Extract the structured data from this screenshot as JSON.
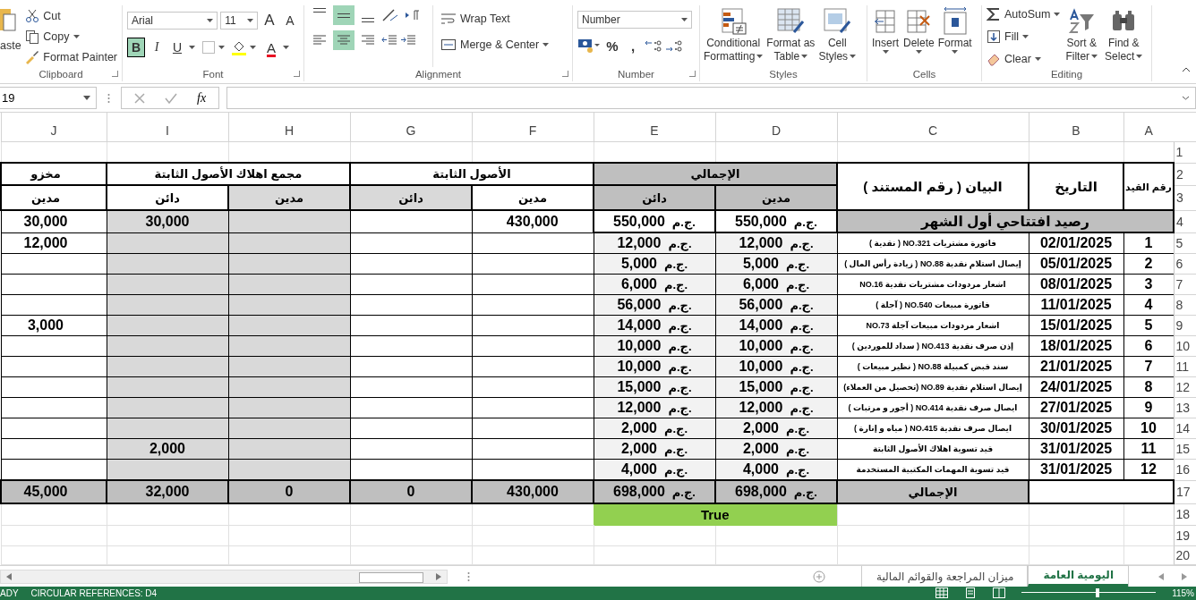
{
  "ribbon": {
    "clipboard": {
      "label": "Clipboard",
      "paste": "aste",
      "cut": "Cut",
      "copy": "Copy",
      "format_painter": "Format Painter"
    },
    "font": {
      "label": "Font",
      "font_name": "Arial",
      "font_size": "11",
      "grow": "A",
      "shrink": "A",
      "bold": {
        "glyph": "B",
        "selected": true
      },
      "italic": {
        "glyph": "I",
        "selected": false
      },
      "underline": {
        "glyph": "U",
        "selected": false
      },
      "font_color": "A"
    },
    "alignment": {
      "label": "Alignment",
      "vertical": [
        {
          "kind": "top",
          "selected": false
        },
        {
          "kind": "middle",
          "selected": true
        },
        {
          "kind": "bottom",
          "selected": false
        }
      ],
      "horizontal": [
        {
          "kind": "left",
          "selected": false
        },
        {
          "kind": "center",
          "selected": true
        },
        {
          "kind": "right",
          "selected": false
        }
      ],
      "wrap_text": "Wrap Text",
      "merge_center": "Merge & Center"
    },
    "number": {
      "label": "Number",
      "format": "Number",
      "percent": "%",
      "comma": ","
    },
    "styles": {
      "label": "Styles",
      "conditional_formatting": [
        "Conditional",
        "Formatting"
      ],
      "format_as_table": [
        "Format as",
        "Table"
      ],
      "cell_styles": [
        "Cell",
        "Styles"
      ]
    },
    "cells": {
      "label": "Cells",
      "insert": "Insert",
      "delete": "Delete",
      "format": "Format"
    },
    "editing": {
      "label": "Editing",
      "autosum": "AutoSum",
      "fill": "Fill",
      "clear": "Clear",
      "sort": [
        "Sort &",
        "Filter"
      ],
      "find": [
        "Find &",
        "Select"
      ]
    }
  },
  "formula_bar": {
    "name_box": "19",
    "fx": "fx"
  },
  "sheet": {
    "column_headers": [
      "A",
      "B",
      "C",
      "D",
      "E",
      "F",
      "G",
      "H",
      "I",
      "J"
    ],
    "row_numbers": [
      "1",
      "2",
      "3",
      "4",
      "5",
      "6",
      "7",
      "8",
      "9",
      "10",
      "11",
      "12",
      "13",
      "14",
      "15",
      "16",
      "17",
      "18",
      "19",
      "20"
    ],
    "headers": {
      "entry_no": "رقم القيد",
      "date": "التاريخ",
      "description": "البيان ( رقم المستند )",
      "total": "الإجمالي",
      "fixed_assets": "الأصول الثابتة",
      "depreciation": "مجمع اهلاك الأصول الثابتة",
      "column_j": "مخزو"
    },
    "sub_headers": [
      "مدين",
      "دائن",
      "مدين",
      "دائن",
      "مدين",
      "دائن",
      "مدين"
    ],
    "opening": {
      "label": "رصيد افتتاحي أول الشهر",
      "debit": {
        "currency": "ج.م.",
        "amount": "550,000"
      },
      "credit": {
        "currency": "ج.م.",
        "amount": "550,000"
      },
      "fixed_assets_debit": "430,000",
      "depreciation_credit": "30,000",
      "column_j_debit": "30,000"
    },
    "entries": [
      {
        "no": "1",
        "date": "02/01/2025",
        "description": "فاتورة مشتريات NO.321 ( نقدية )",
        "debit": {
          "currency": "ج.م.",
          "amount": "12,000"
        },
        "credit": {
          "currency": "ج.م.",
          "amount": "12,000"
        },
        "column_j_debit": "12,000"
      },
      {
        "no": "2",
        "date": "05/01/2025",
        "description": "إيصال استلام نقدية NO.88 ( زيادة رأس المال )",
        "debit": {
          "currency": "ج.م.",
          "amount": "5,000"
        },
        "credit": {
          "currency": "ج.م.",
          "amount": "5,000"
        }
      },
      {
        "no": "3",
        "date": "08/01/2025",
        "description": "اشعار مردودات مشتريات نقدية NO.16",
        "debit": {
          "currency": "ج.م.",
          "amount": "6,000"
        },
        "credit": {
          "currency": "ج.م.",
          "amount": "6,000"
        }
      },
      {
        "no": "4",
        "date": "11/01/2025",
        "description": "فاتورة مبيعات NO.540 ( آجلة )",
        "debit": {
          "currency": "ج.م.",
          "amount": "56,000"
        },
        "credit": {
          "currency": "ج.م.",
          "amount": "56,000"
        }
      },
      {
        "no": "5",
        "date": "15/01/2025",
        "description": "اشعار مردودات مبيعات آجلة NO.73",
        "debit": {
          "currency": "ج.م.",
          "amount": "14,000"
        },
        "credit": {
          "currency": "ج.م.",
          "amount": "14,000"
        },
        "column_j_debit": "3,000"
      },
      {
        "no": "6",
        "date": "18/01/2025",
        "description": "إذن صرف نقدية NO.413 ( سداد للموردين )",
        "debit": {
          "currency": "ج.م.",
          "amount": "10,000"
        },
        "credit": {
          "currency": "ج.م.",
          "amount": "10,000"
        }
      },
      {
        "no": "7",
        "date": "21/01/2025",
        "description": "سند قبض كمبيلة NO.88 ( نظير مبيعات )",
        "debit": {
          "currency": "ج.م.",
          "amount": "10,000"
        },
        "credit": {
          "currency": "ج.م.",
          "amount": "10,000"
        }
      },
      {
        "no": "8",
        "date": "24/01/2025",
        "description": "إيصال استلام نقدية NO.89 (تحصيل من العملاء)",
        "debit": {
          "currency": "ج.م.",
          "amount": "15,000"
        },
        "credit": {
          "currency": "ج.م.",
          "amount": "15,000"
        }
      },
      {
        "no": "9",
        "date": "27/01/2025",
        "description": "ايصال صرف نقدية NO.414 ( أجور و مرتبات )",
        "debit": {
          "currency": "ج.م.",
          "amount": "12,000"
        },
        "credit": {
          "currency": "ج.م.",
          "amount": "12,000"
        }
      },
      {
        "no": "10",
        "date": "30/01/2025",
        "description": "ايصال صرف نقدية NO.415 ( مياه و إنارة )",
        "debit": {
          "currency": "ج.م.",
          "amount": "2,000"
        },
        "credit": {
          "currency": "ج.م.",
          "amount": "2,000"
        }
      },
      {
        "no": "11",
        "date": "31/01/2025",
        "description": "قيد تسوية اهلاك الأصول الثابتة",
        "debit": {
          "currency": "ج.م.",
          "amount": "2,000"
        },
        "credit": {
          "currency": "ج.م.",
          "amount": "2,000"
        },
        "depreciation_credit": "2,000"
      },
      {
        "no": "12",
        "date": "31/01/2025",
        "description": "قيد تسوية المهمات المكتبية المستخدمة",
        "debit": {
          "currency": "ج.م.",
          "amount": "4,000"
        },
        "credit": {
          "currency": "ج.م.",
          "amount": "4,000"
        }
      }
    ],
    "totals": {
      "label": "الإجمالي",
      "debit": {
        "currency": "ج.م.",
        "amount": "698,000"
      },
      "credit": {
        "currency": "ج.م.",
        "amount": "698,000"
      },
      "fixed_assets_debit": "430,000",
      "fixed_assets_credit": "0",
      "depreciation_debit": "0",
      "depreciation_credit": "32,000",
      "column_j_debit": "45,000"
    },
    "check": "True"
  },
  "sheet_tabs": [
    {
      "label": "اليومية العامة",
      "selected": true
    },
    {
      "label": "ميزان المراجعة والقوائم المالية",
      "selected": false
    }
  ],
  "status_bar": {
    "mode": "ADY",
    "message": "CIRCULAR REFERENCES: D4",
    "zoom_slider": {
      "level": 0.57
    },
    "zoom": "115%"
  }
}
